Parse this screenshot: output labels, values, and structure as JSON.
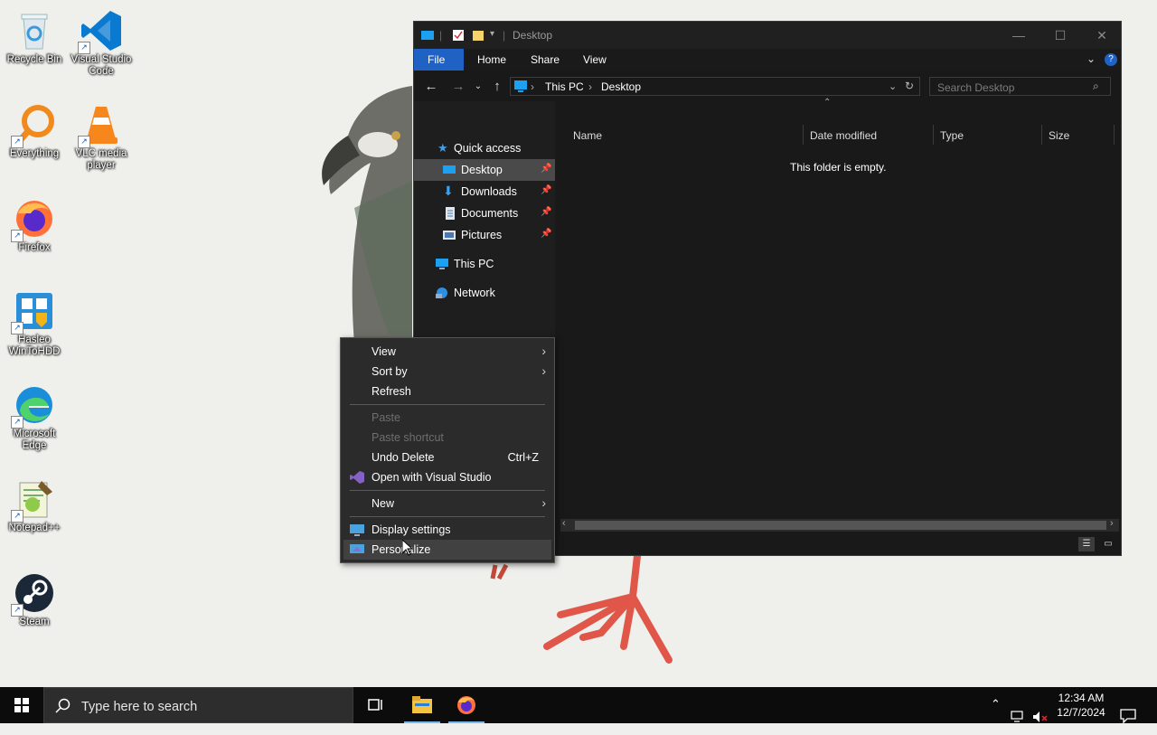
{
  "desktop": {
    "icons": [
      {
        "label": "Recycle Bin"
      },
      {
        "label": "Visual Studio Code"
      },
      {
        "label": "Everything"
      },
      {
        "label": "VLC media player"
      },
      {
        "label": "Firefox"
      },
      {
        "label": "Hasleo WinToHDD"
      },
      {
        "label": "Microsoft Edge"
      },
      {
        "label": "Notepad++"
      },
      {
        "label": "Steam"
      }
    ]
  },
  "explorer": {
    "title": "Desktop",
    "ribbon_tabs": [
      "File",
      "Home",
      "Share",
      "View"
    ],
    "breadcrumb": [
      "This PC",
      "Desktop"
    ],
    "search_placeholder": "Search Desktop",
    "nav": {
      "quick_access": "Quick access",
      "items": [
        {
          "label": "Desktop",
          "pinned": true,
          "selected": true
        },
        {
          "label": "Downloads",
          "pinned": true
        },
        {
          "label": "Documents",
          "pinned": true
        },
        {
          "label": "Pictures",
          "pinned": true
        }
      ],
      "this_pc": "This PC",
      "network": "Network"
    },
    "columns": [
      "Name",
      "Date modified",
      "Type",
      "Size"
    ],
    "empty_message": "This folder is empty."
  },
  "context_menu": {
    "items": [
      {
        "label": "View",
        "submenu": true
      },
      {
        "label": "Sort by",
        "submenu": true
      },
      {
        "label": "Refresh"
      },
      {
        "label": "Paste",
        "disabled": true
      },
      {
        "label": "Paste shortcut",
        "disabled": true
      },
      {
        "label": "Undo Delete",
        "shortcut": "Ctrl+Z"
      },
      {
        "label": "Open with Visual Studio"
      },
      {
        "label": "New",
        "submenu": true
      },
      {
        "label": "Display settings"
      },
      {
        "label": "Personalize",
        "hover": true
      }
    ]
  },
  "taskbar": {
    "search_placeholder": "Type here to search",
    "time": "12:34 AM",
    "date": "12/7/2024"
  },
  "colors": {
    "accent": "#1f62c4",
    "window_bg": "#191919",
    "menu_bg": "#2b2b2b",
    "taskbar_bg": "#0c0c0c"
  }
}
